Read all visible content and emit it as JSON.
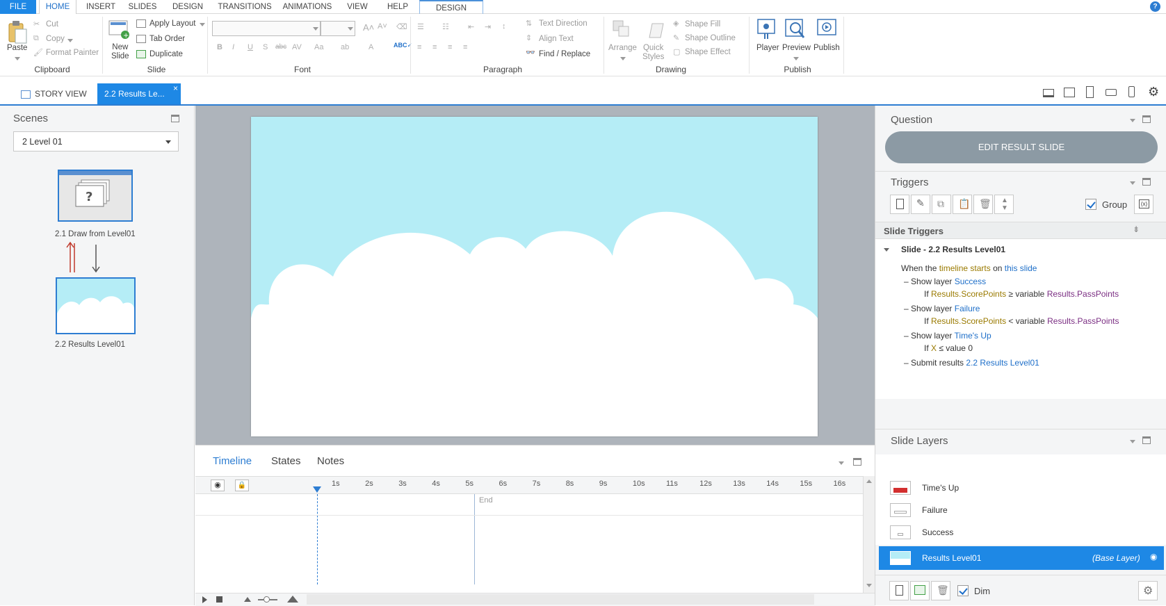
{
  "menu": {
    "file": "FILE",
    "tabs": [
      "HOME",
      "INSERT",
      "SLIDES",
      "DESIGN",
      "TRANSITIONS",
      "ANIMATIONS",
      "VIEW",
      "HELP"
    ],
    "contextual": "DESIGN",
    "help": "?"
  },
  "ribbon": {
    "clipboard": {
      "paste": "Paste",
      "cut": "Cut",
      "copy": "Copy",
      "format_painter": "Format Painter",
      "group": "Clipboard"
    },
    "slide": {
      "new_slide": "New\nSlide",
      "apply_layout": "Apply Layout",
      "tab_order": "Tab Order",
      "duplicate": "Duplicate",
      "group": "Slide"
    },
    "font": {
      "group": "Font"
    },
    "paragraph": {
      "text_direction": "Text Direction",
      "align_text": "Align Text",
      "find_replace": "Find / Replace",
      "group": "Paragraph"
    },
    "drawing": {
      "arrange": "Arrange",
      "quick_styles": "Quick\nStyles",
      "shape_fill": "Shape Fill",
      "shape_outline": "Shape Outline",
      "shape_effect": "Shape Effect",
      "group": "Drawing"
    },
    "publish": {
      "player": "Player",
      "preview": "Preview",
      "publish": "Publish",
      "group": "Publish"
    }
  },
  "doc_tabs": {
    "story_view": "STORY VIEW",
    "active": "2.2 Results Le..."
  },
  "scenes": {
    "title": "Scenes",
    "selected_scene": "2 Level 01",
    "slides": [
      {
        "label": "2.1 Draw from Level01"
      },
      {
        "label": "2.2 Results Level01"
      }
    ]
  },
  "timeline": {
    "tabs": [
      "Timeline",
      "States",
      "Notes"
    ],
    "ticks": [
      "1s",
      "2s",
      "3s",
      "4s",
      "5s",
      "6s",
      "7s",
      "8s",
      "9s",
      "10s",
      "11s",
      "12s",
      "13s",
      "14s",
      "15s",
      "16s"
    ],
    "end_label": "End"
  },
  "question": {
    "title": "Question",
    "edit_button": "EDIT RESULT SLIDE"
  },
  "triggers": {
    "title": "Triggers",
    "group_label": "Group",
    "section": "Slide Triggers",
    "slide_heading": "Slide - 2.2 Results Level01",
    "when": {
      "prefix": "When the",
      "event": "timeline starts",
      "on": "on",
      "target": "this slide"
    },
    "items": [
      {
        "action": "Show layer",
        "target": "Success",
        "cond_if": "If",
        "cond_var": "Results.ScorePoints",
        "cond_op": "≥ variable",
        "cond_val": "Results.PassPoints"
      },
      {
        "action": "Show layer",
        "target": "Failure",
        "cond_if": "If",
        "cond_var": "Results.ScorePoints",
        "cond_op": "< variable",
        "cond_val": "Results.PassPoints"
      },
      {
        "action": "Show layer",
        "target": "Time's Up",
        "cond_if": "If",
        "cond_var": "X",
        "cond_op": "≤ value",
        "cond_val": "0"
      }
    ],
    "submit": {
      "action": "Submit results",
      "target": "2.2 Results Level01"
    }
  },
  "layers": {
    "title": "Slide Layers",
    "items": [
      "Time's Up",
      "Failure",
      "Success"
    ],
    "base": {
      "name": "Results Level01",
      "tag": "(Base Layer)"
    },
    "dim_label": "Dim"
  },
  "colors": {
    "accent": "#2d7dd2",
    "sky": "#b5edf6",
    "selected": "#1e88e5"
  }
}
